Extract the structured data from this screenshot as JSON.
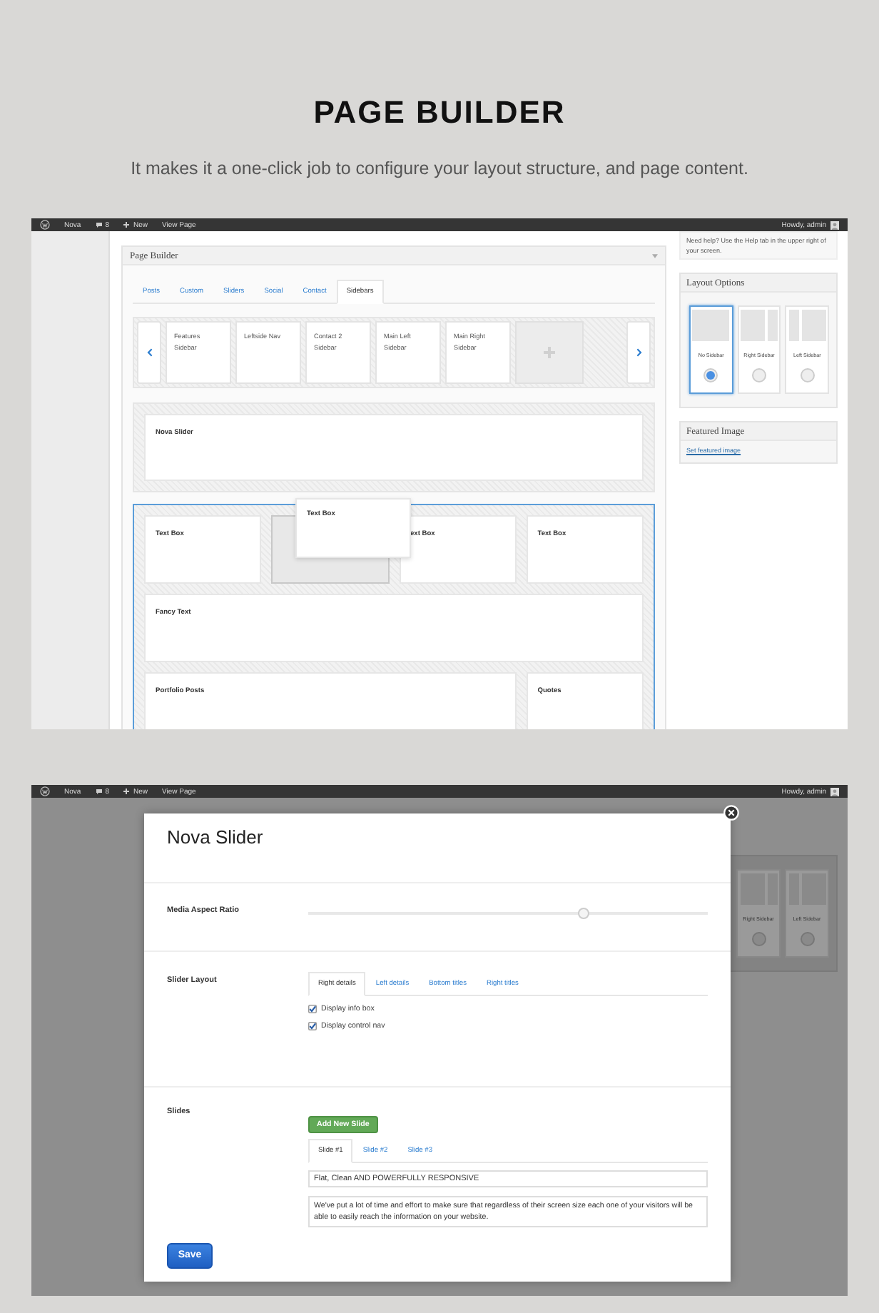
{
  "header": {
    "title": "PAGE BUILDER",
    "subtitle": "It makes it a one-click job to configure your layout structure, and page content."
  },
  "builder_view": {
    "admin_bar": {
      "items": [
        {
          "kind": "site",
          "label": "Nova"
        },
        {
          "kind": "comments",
          "label": "8"
        },
        {
          "kind": "new",
          "label": "New"
        },
        {
          "kind": "link",
          "label": "View Page"
        }
      ],
      "greeting": "Howdy, admin"
    },
    "page_builder": {
      "title": "Page Builder",
      "tabs": [
        {
          "label": "Posts",
          "selected": false
        },
        {
          "label": "Custom",
          "selected": false
        },
        {
          "label": "Sliders",
          "selected": false
        },
        {
          "label": "Social",
          "selected": false
        },
        {
          "label": "Contact",
          "selected": false
        },
        {
          "label": "Sidebars",
          "selected": true
        }
      ],
      "widgets": [
        "Features Sidebar",
        "Leftside Nav",
        "Contact 2 Sidebar",
        "Main Left Sidebar",
        "Main Right Sidebar"
      ],
      "rows": [
        {
          "selected": false,
          "modules": [
            {
              "kind": "full",
              "label": "Nova Slider"
            }
          ]
        },
        {
          "selected": true,
          "dragging": "Text Box",
          "modules": [
            {
              "kind": "quarter",
              "label": "Text Box"
            },
            {
              "kind": "placeholder"
            },
            {
              "kind": "quarter",
              "label": "ext Box"
            },
            {
              "kind": "quarter",
              "label": "Text Box"
            },
            {
              "kind": "full",
              "label": "Fancy Text"
            },
            {
              "kind": "three_quarters",
              "label": "Portfolio Posts"
            },
            {
              "kind": "quarter",
              "label": "Quotes"
            }
          ]
        }
      ]
    },
    "help_text": "Need help? Use the Help tab in the upper right of your screen.",
    "layout_options": {
      "title": "Layout Options",
      "options": [
        {
          "kind": "none",
          "label": "No Sidebar",
          "selected": true
        },
        {
          "kind": "right",
          "label": "Right Sidebar",
          "selected": false
        },
        {
          "kind": "left",
          "label": "Left Sidebar",
          "selected": false
        }
      ]
    },
    "featured_image": {
      "title": "Featured Image",
      "link": "Set featured image"
    }
  },
  "modal_view": {
    "admin_bar": {
      "items": [
        {
          "kind": "site",
          "label": "Nova"
        },
        {
          "kind": "comments",
          "label": "8"
        },
        {
          "kind": "new",
          "label": "New"
        },
        {
          "kind": "link",
          "label": "View Page"
        }
      ],
      "greeting": "Howdy, admin"
    },
    "background_options": [
      {
        "kind": "right",
        "label": "Right Sidebar",
        "selected": false
      },
      {
        "kind": "left",
        "label": "Left Sidebar",
        "selected": false
      }
    ],
    "modal": {
      "title": "Nova Slider",
      "aspect_ratio": {
        "label": "Media Aspect Ratio",
        "level": 0.69
      },
      "layout": {
        "label": "Slider Layout",
        "tabs": [
          {
            "label": "Right details",
            "selected": true
          },
          {
            "label": "Left details",
            "selected": false
          },
          {
            "label": "Bottom titles",
            "selected": false
          },
          {
            "label": "Right titles",
            "selected": false
          }
        ],
        "options": [
          {
            "label": "Display info box",
            "checked": true
          },
          {
            "label": "Display control nav",
            "checked": true
          }
        ]
      },
      "slides": {
        "label": "Slides",
        "add_button": "Add New Slide",
        "tabs": [
          {
            "label": "Slide #1",
            "selected": true
          },
          {
            "label": "Slide #2",
            "selected": false
          },
          {
            "label": "Slide #3",
            "selected": false
          }
        ],
        "title_value": "Flat, Clean AND POWERFULLY RESPONSIVE",
        "text_value": "We've put a lot of time and effort to make sure that regardless of their screen size each one of your visitors will be able to easily reach the information on your website."
      },
      "save_button": "Save"
    }
  }
}
